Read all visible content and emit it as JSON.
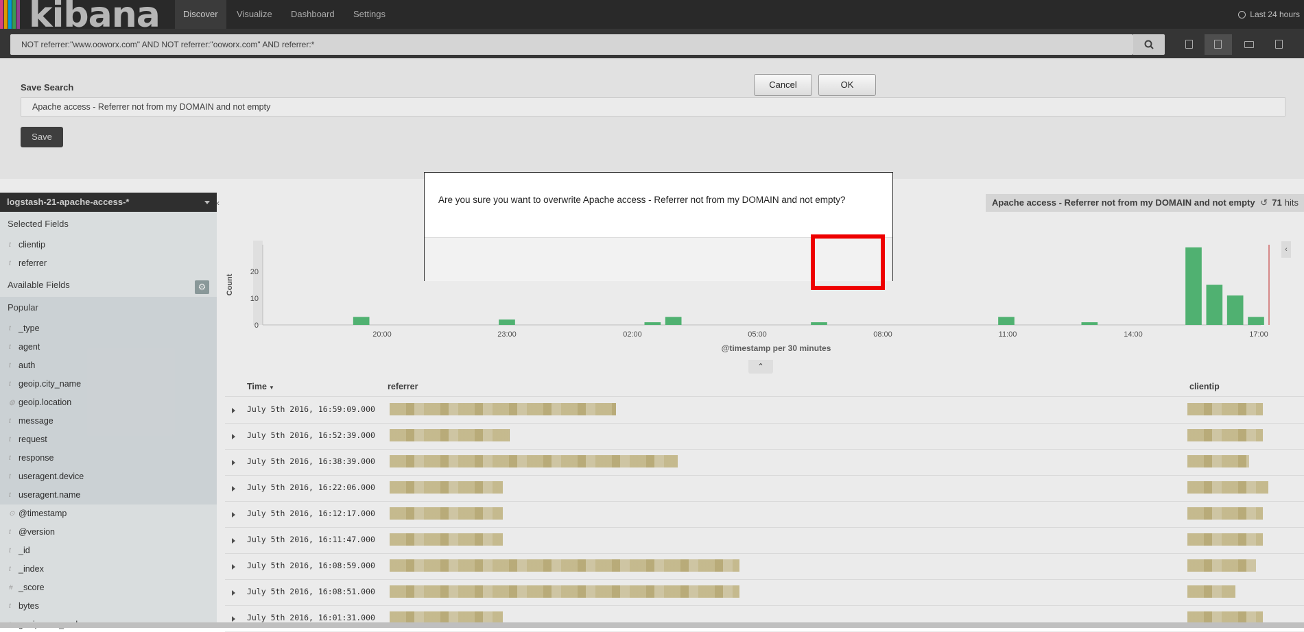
{
  "app": {
    "logo_text": "kibana",
    "colors": [
      "#e8478b",
      "#f0a900",
      "#00a9e5",
      "#3eaa5b",
      "#a0469b"
    ]
  },
  "nav": {
    "tabs": [
      {
        "label": "Discover",
        "active": true
      },
      {
        "label": "Visualize"
      },
      {
        "label": "Dashboard"
      },
      {
        "label": "Settings"
      }
    ],
    "time_range": "Last 24 hours",
    "clock_icon": "clock-icon"
  },
  "query": {
    "value": "NOT referrer:\"www.ooworx.com\" AND NOT referrer:\"ooworx.com\" AND referrer:*",
    "search_icon": "search-icon",
    "toolbar_icons": [
      "new-search-icon",
      "save-search-icon",
      "open-search-icon",
      "share-icon"
    ]
  },
  "save_search": {
    "title": "Save Search",
    "input_value": "Apache access - Referrer not from my DOMAIN and not empty",
    "button": "Save"
  },
  "sidebar": {
    "index_pattern": "logstash-21-apache-access-*",
    "selected_header": "Selected Fields",
    "selected_fields": [
      {
        "type": "t",
        "name": "clientip"
      },
      {
        "type": "t",
        "name": "referrer"
      }
    ],
    "available_header": "Available Fields",
    "popular_header": "Popular",
    "popular_fields": [
      {
        "type": "t",
        "name": "_type"
      },
      {
        "type": "t",
        "name": "agent"
      },
      {
        "type": "t",
        "name": "auth"
      },
      {
        "type": "t",
        "name": "geoip.city_name"
      },
      {
        "type": "◍",
        "name": "geoip.location"
      },
      {
        "type": "t",
        "name": "message"
      },
      {
        "type": "t",
        "name": "request"
      },
      {
        "type": "t",
        "name": "response"
      },
      {
        "type": "t",
        "name": "useragent.device"
      },
      {
        "type": "t",
        "name": "useragent.name"
      }
    ],
    "other_fields": [
      {
        "type": "⊙",
        "name": "@timestamp"
      },
      {
        "type": "t",
        "name": "@version"
      },
      {
        "type": "t",
        "name": "_id"
      },
      {
        "type": "t",
        "name": "_index"
      },
      {
        "type": "#",
        "name": "_score"
      },
      {
        "type": "t",
        "name": "bytes"
      },
      {
        "type": "t",
        "name": "geoip.area_code"
      }
    ]
  },
  "results": {
    "saved_search_title": "Apache access - Referrer not from my DOMAIN and not empty",
    "hits_count": "71",
    "hits_label": "hits"
  },
  "chart_data": {
    "type": "bar",
    "xlabel": "@timestamp per 30 minutes",
    "ylabel": "Count",
    "ylim": [
      0,
      30
    ],
    "yticks": [
      0,
      10,
      20
    ],
    "xticks": [
      "20:00",
      "23:00",
      "02:00",
      "05:00",
      "08:00",
      "11:00",
      "14:00",
      "17:00"
    ],
    "x": [
      "19:30",
      "23:00",
      "02:30",
      "03:00",
      "06:30",
      "11:00",
      "13:00",
      "15:30",
      "16:00",
      "16:30",
      "17:00"
    ],
    "values": [
      3,
      2,
      1,
      3,
      1,
      3,
      1,
      29,
      15,
      11,
      3
    ],
    "color": "#57c17b"
  },
  "table": {
    "columns": [
      "Time",
      "referrer",
      "clientip"
    ],
    "rows": [
      {
        "time": "July 5th 2016, 16:59:09.000"
      },
      {
        "time": "July 5th 2016, 16:52:39.000"
      },
      {
        "time": "July 5th 2016, 16:38:39.000"
      },
      {
        "time": "July 5th 2016, 16:22:06.000"
      },
      {
        "time": "July 5th 2016, 16:12:17.000"
      },
      {
        "time": "July 5th 2016, 16:11:47.000"
      },
      {
        "time": "July 5th 2016, 16:08:59.000"
      },
      {
        "time": "July 5th 2016, 16:08:51.000"
      },
      {
        "time": "July 5th 2016, 16:01:31.000"
      }
    ]
  },
  "modal": {
    "message": "Are you sure you want to overwrite Apache access - Referrer not from my DOMAIN and not empty?",
    "cancel": "Cancel",
    "ok": "OK"
  }
}
